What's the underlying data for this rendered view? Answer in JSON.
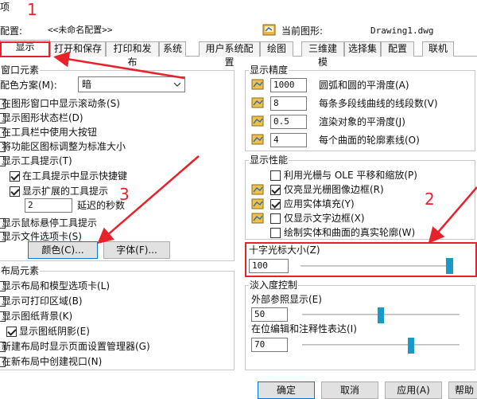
{
  "window": {
    "title_fragment": "项"
  },
  "profile": {
    "label": "配置:",
    "value": "<<未命名配置>>"
  },
  "drawing": {
    "label": "当前图形:",
    "value": "Drawing1.dwg"
  },
  "tabs": [
    {
      "label": "显示",
      "active": true
    },
    {
      "label": "打开和保存",
      "active": false
    },
    {
      "label": "打印和发布",
      "active": false
    },
    {
      "label": "系统",
      "active": false
    },
    {
      "label": "用户系统配置",
      "active": false
    },
    {
      "label": "绘图",
      "active": false
    },
    {
      "label": "三维建模",
      "active": false
    },
    {
      "label": "选择集",
      "active": false
    },
    {
      "label": "配置",
      "active": false
    },
    {
      "label": "联机",
      "active": false
    }
  ],
  "window_elements": {
    "group_label": "窗口元素",
    "color_scheme_label": "配色方案(M):",
    "color_scheme_value": "暗",
    "options": [
      {
        "label": "在图形窗口中显示滚动条(S)",
        "checked": false
      },
      {
        "label": "显示图形状态栏(D)",
        "checked": false
      },
      {
        "label": "在工具栏中使用大按钮",
        "checked": false
      },
      {
        "label": "将功能区图标调整为标准大小",
        "checked": false
      },
      {
        "label": "显示工具提示(T)",
        "checked": false
      },
      {
        "label": "在工具提示中显示快捷键",
        "checked": true
      },
      {
        "label": "显示扩展的工具提示",
        "checked": true
      }
    ],
    "delay_value": "2",
    "delay_label": "延迟的秒数",
    "rollover_label": "显示鼠标悬停工具提示",
    "file_tabs_label": "显示文件选项卡(S)",
    "colors_button": "颜色(C)...",
    "fonts_button": "字体(F)..."
  },
  "layout_elements": {
    "group_label": "布局元素",
    "options": [
      {
        "label": "显示布局和模型选项卡(L)",
        "checked": false
      },
      {
        "label": "显示可打印区域(B)",
        "checked": false
      },
      {
        "label": "显示图纸背景(K)",
        "checked": false
      },
      {
        "label": "显示图纸阴影(E)",
        "checked": true
      },
      {
        "label": "新建布局时显示页面设置管理器(G)",
        "checked": false
      },
      {
        "label": "在新布局中创建视口(N)",
        "checked": false
      }
    ]
  },
  "display_resolution": {
    "group_label": "显示精度",
    "rows": [
      {
        "value": "1000",
        "label": "圆弧和圆的平滑度(A)"
      },
      {
        "value": "8",
        "label": "每条多段线曲线的线段数(V)"
      },
      {
        "value": "0.5",
        "label": "渲染对象的平滑度(J)"
      },
      {
        "value": "4",
        "label": "每个曲面的轮廓素线(O)"
      }
    ]
  },
  "display_performance": {
    "group_label": "显示性能",
    "options": [
      {
        "label": "利用光栅与 OLE 平移和缩放(P)",
        "checked": false,
        "icon": false
      },
      {
        "label": "仅亮显光栅图像边框(R)",
        "checked": true,
        "icon": true
      },
      {
        "label": "应用实体填充(Y)",
        "checked": true,
        "icon": true
      },
      {
        "label": "仅显示文字边框(X)",
        "checked": false,
        "icon": true
      },
      {
        "label": "绘制实体和曲面的真实轮廓(W)",
        "checked": false,
        "icon": false
      }
    ]
  },
  "crosshair": {
    "label": "十字光标大小(Z)",
    "value": "100",
    "level_percent": 100
  },
  "fade_control": {
    "group_label": "淡入度控制",
    "xref_label": "外部参照显示(E)",
    "xref_value": "50",
    "xref_level_percent": 50,
    "inplace_label": "在位编辑和注释性表达(I)",
    "inplace_value": "70",
    "inplace_level_percent": 70
  },
  "footer": {
    "ok": "确定",
    "cancel": "取消",
    "apply": "应用(A)",
    "help": "帮助"
  },
  "annotations": {
    "n1": "1",
    "n2": "2",
    "n3": "3",
    "color": "#e8222b"
  },
  "icons": {
    "drawing": "drawing-file-icon",
    "resolution": "resolution-setting-icon",
    "performance": "performance-setting-icon",
    "dropdown": "chevron-down-icon"
  }
}
